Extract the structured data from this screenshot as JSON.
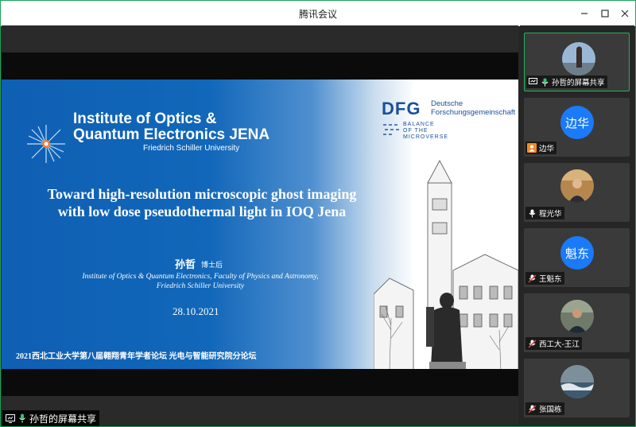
{
  "window": {
    "title": "腾讯会议"
  },
  "slide": {
    "institute_line1": "Institute of Optics &",
    "institute_line2": "Quantum Electronics JENA",
    "university": "Friedrich Schiller University",
    "dfg_logo": "DFG",
    "dfg_line1": "Deutsche",
    "dfg_line2": "Forschungsgemeinschaft",
    "balance_line1": "BALANCE",
    "balance_line2": "OF THE",
    "balance_line3": "MICROVERSE",
    "title": "Toward high-resolution microscopic ghost imaging with low dose pseudothermal light in IOQ Jena",
    "author": "孙哲",
    "author_role": "博士后",
    "affiliation_line1": "Institute of Optics & Quantum Electronics, Faculty of Physics and Astronomy,",
    "affiliation_line2": "Friedrich Schiller University",
    "date": "28.10.2021",
    "footer": "2021西北工业大学第八届翱翔青年学者论坛 光电与智能研究院分论坛"
  },
  "share_label": "孙哲的屏幕共享",
  "participants": [
    {
      "name": "孙哲的屏幕共享",
      "type": "photo",
      "status": "sharing",
      "active": true
    },
    {
      "name": "边华",
      "type": "text",
      "avatar_text": "边华",
      "status": "user"
    },
    {
      "name": "程光华",
      "type": "photo",
      "status": "mic"
    },
    {
      "name": "王魁东",
      "type": "text",
      "avatar_text": "魁东",
      "status": "muted"
    },
    {
      "name": "西工大-王江",
      "type": "photo",
      "status": "muted"
    },
    {
      "name": "张国栋",
      "type": "photo",
      "status": "muted"
    }
  ],
  "colors": {
    "accent": "#1aa35a",
    "avatar_blue": "#1a7af8",
    "slide_blue": "#0f5fb3",
    "mute_red": "#e0443a"
  },
  "icons": [
    "minimize-icon",
    "maximize-icon",
    "close-icon",
    "screen-share-icon",
    "microphone-icon",
    "microphone-muted-icon",
    "user-icon"
  ]
}
